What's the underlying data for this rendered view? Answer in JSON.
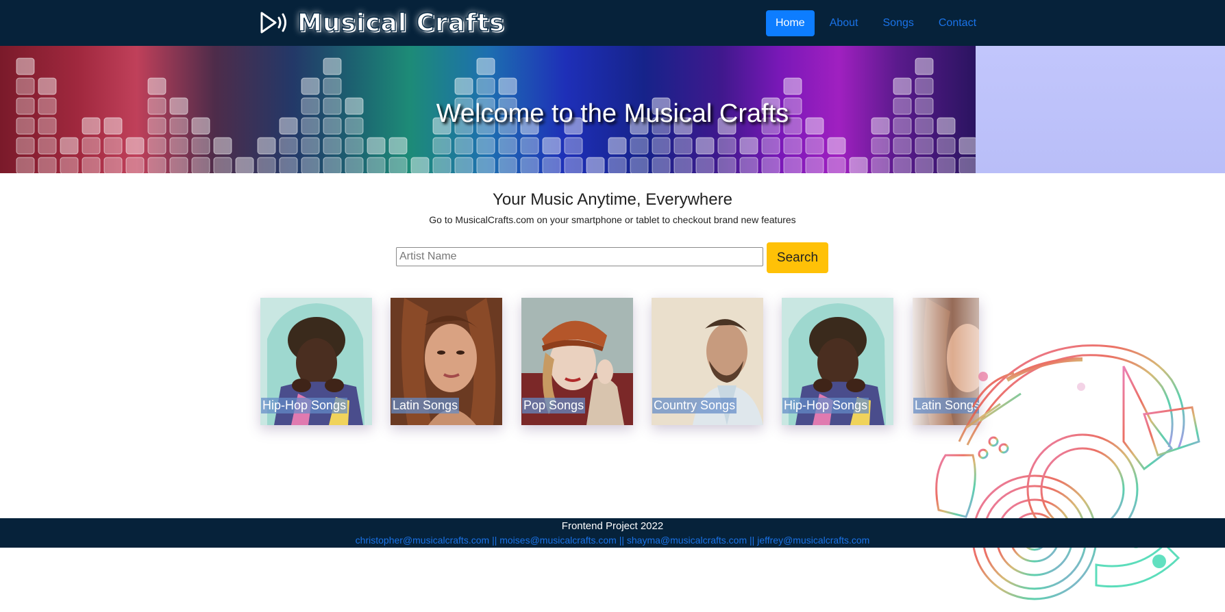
{
  "brand": {
    "name": "Musical Crafts",
    "logo_icon": "play-sound-icon"
  },
  "nav": {
    "items": [
      {
        "label": "Home",
        "active": true
      },
      {
        "label": "About",
        "active": false
      },
      {
        "label": "Songs",
        "active": false
      },
      {
        "label": "Contact",
        "active": false
      }
    ]
  },
  "hero": {
    "title": "Welcome to the Musical Crafts"
  },
  "main": {
    "heading": "Your Music Anytime, Everywhere",
    "subheading": "Go to MusicalCrafts.com on your smartphone or tablet to checkout brand new features"
  },
  "search": {
    "placeholder": "Artist Name",
    "value": "",
    "button_label": "Search"
  },
  "cards": [
    {
      "label": "Hip-Hop Songs"
    },
    {
      "label": "Latin Songs"
    },
    {
      "label": "Pop Songs"
    },
    {
      "label": "Country Songs"
    },
    {
      "label": "Hip-Hop Songs"
    },
    {
      "label": "Latin Songs"
    }
  ],
  "footer": {
    "title": "Frontend Project 2022",
    "emails": [
      "christopher@musicalcrafts.com",
      "moises@musicalcrafts.com",
      "shayma@musicalcrafts.com",
      "jeffrey@musicalcrafts.com"
    ],
    "separator": "||"
  },
  "colors": {
    "navbar": "#06223a",
    "active_nav": "#0d7dff",
    "link": "#1a73e8",
    "search_button": "#ffc107",
    "hero_side": "#c2c6fc"
  }
}
